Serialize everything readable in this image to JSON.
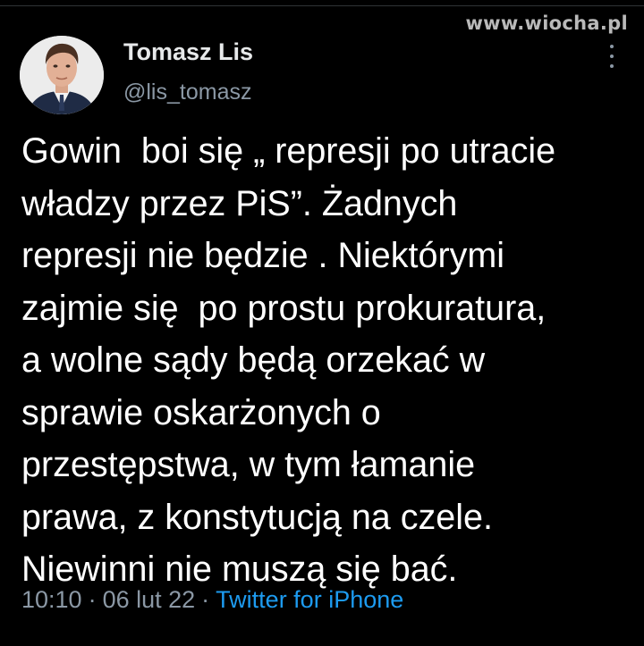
{
  "watermark": "www.wiocha.pl",
  "tweet": {
    "author_name": "Tomasz Lis",
    "author_handle": "@lis_tomasz",
    "text": "Gowin  boi się „ represji po utracie\nwładzy przez PiS”. Żadnych\nrepresji nie będzie . Niektórymi\nzajmie się  po prostu prokuratura,\na wolne sądy będą orzekać w\nsprawie oskarżonych o\nprzestępstwa, w tym łamanie\nprawa, z konstytucją na czele.\nNiewinni nie muszą się bać.",
    "time": "10:10",
    "separator": "·",
    "date": "06 lut 22",
    "source": "Twitter for iPhone"
  },
  "icons": {
    "more": "more-vertical-icon",
    "avatar": "profile-photo"
  },
  "colors": {
    "background": "#000000",
    "text": "#ffffff",
    "secondary": "#8b98a5",
    "link": "#1d9bf0"
  }
}
